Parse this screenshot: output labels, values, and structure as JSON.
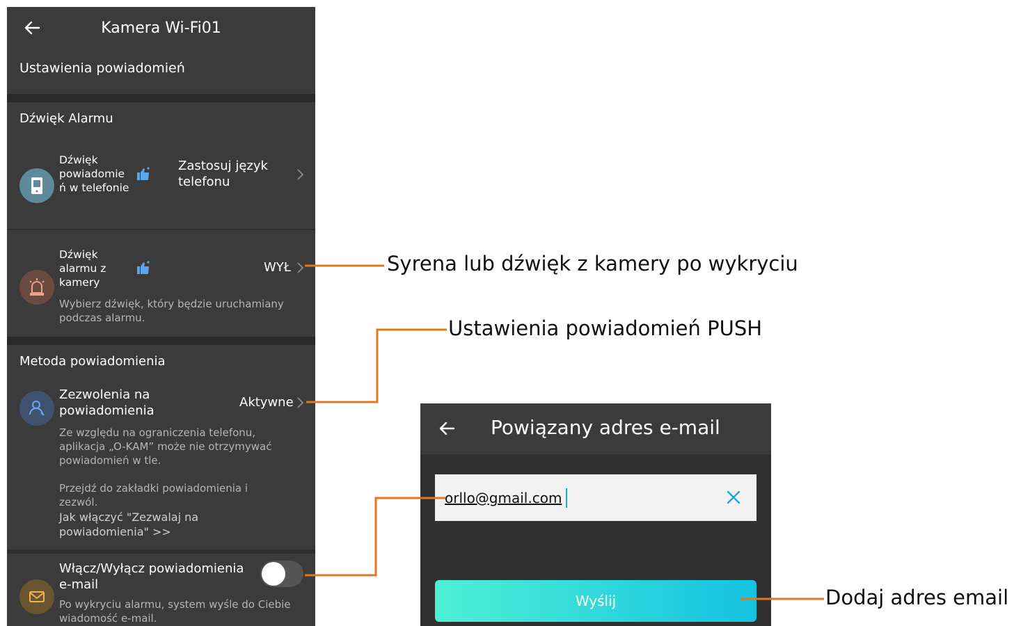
{
  "header": {
    "title": "Kamera Wi-Fi01",
    "subtitle": "Ustawienia powiadomień"
  },
  "alarm_section": {
    "title": "Dźwięk Alarmu",
    "phone_sound": {
      "label_lines": [
        "Dźwięk",
        "powiadomie",
        "ń w telefonie"
      ],
      "value_lines": [
        "Zastosuj język",
        "telefonu"
      ],
      "icon": "phone-icon"
    },
    "camera_sound": {
      "label_lines": [
        "Dźwięk",
        "alarmu z",
        "kamery"
      ],
      "value": "WYŁ",
      "description_lines": [
        "Wybierz dźwięk, który będzie uruchamiany",
        "podczas alarmu."
      ],
      "icon": "siren-icon"
    }
  },
  "method_section": {
    "title": "Metoda powiadomienia",
    "permissions": {
      "label_lines": [
        "Zezwolenia na",
        "powiadomienia"
      ],
      "value": "Aktywne",
      "description_lines": [
        "Ze względu na ograniczenia telefonu,",
        "aplikacja „O-KAM” może nie  otrzymywać",
        "powiadomień w tle.",
        "",
        "Przejdź do zakładki powiadomienia i",
        "zezwól."
      ],
      "link_lines": [
        "Jak włączyć \"Zezwalaj na",
        "powiadomienia\" >>"
      ],
      "icon": "user-icon"
    },
    "email": {
      "label_lines": [
        "Włącz/Wyłącz powiadomienia",
        "e-mail"
      ],
      "description_lines": [
        "Po wykryciu alarmu, system wyśle do Ciebie",
        "wiadomość e-mail."
      ],
      "enabled": false,
      "icon": "mail-icon"
    }
  },
  "email_dialog": {
    "title": "Powiązany adres e-mail",
    "input_value": "orllo@gmail.com",
    "send_label": "Wyślij"
  },
  "callouts": {
    "siren": "Syrena lub dźwięk z kamery po wykryciu",
    "push": "Ustawienia powiadomień PUSH",
    "add_email": "Dodaj adres email"
  },
  "colors": {
    "panel": "#3b3b3b",
    "gap": "#2a2a2a",
    "leader": "#e07a1f",
    "accent": "#14c2e2",
    "thumb": "#5aa6e6"
  }
}
